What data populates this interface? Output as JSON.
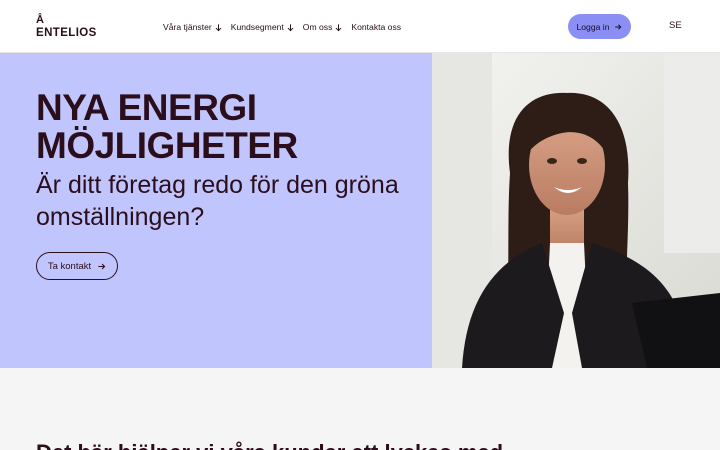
{
  "header": {
    "logo_mark": "Å",
    "logo_text": "ENTELIOS",
    "nav": [
      {
        "label": "Våra tjänster",
        "has_dropdown": true
      },
      {
        "label": "Kundsegment",
        "has_dropdown": true
      },
      {
        "label": "Om oss",
        "has_dropdown": true
      },
      {
        "label": "Kontakta oss",
        "has_dropdown": false
      }
    ],
    "login_label": "Logga in",
    "login_icon": "arrow-right-icon",
    "language": "SE"
  },
  "hero": {
    "title_line1": "NYA ENERGI",
    "title_line2": "MÖJLIGHETER",
    "subtitle": "Är ditt företag redo för den gröna omställningen?",
    "cta_label": "Ta kontakt",
    "cta_icon": "arrow-right-icon",
    "image": "smiling-woman-portrait"
  },
  "section": {
    "title": "Det här hjälper vi våra kunder att lyckas med"
  },
  "colors": {
    "brand_text": "#2a0e1c",
    "hero_bg": "#c1c5fd",
    "button_accent": "#8b8ef2",
    "page_bg": "#f5f5f5"
  }
}
